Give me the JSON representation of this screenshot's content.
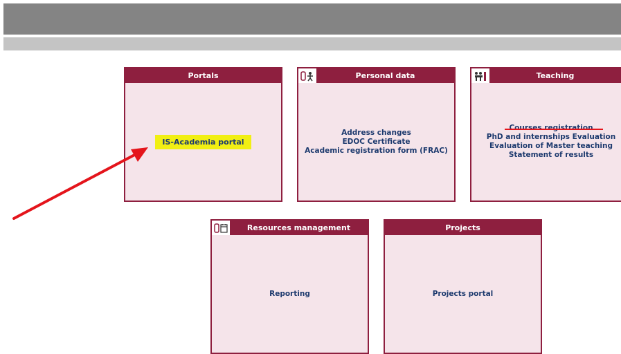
{
  "portals": {
    "title": "Portals",
    "items": [
      "IS-Academia portal"
    ]
  },
  "personal_data": {
    "title": "Personal data",
    "items": [
      "Address changes",
      "EDOC Certificate",
      "Academic registration form (FRAC)"
    ]
  },
  "teaching": {
    "title": "Teaching",
    "items": [
      "Courses registration",
      "PhD and internships Evaluation",
      "Evaluation of Master teaching",
      "Statement of results"
    ]
  },
  "resources": {
    "title": "Resources management",
    "items": [
      "Reporting"
    ]
  },
  "projects": {
    "title": "Projects",
    "items": [
      "Projects portal"
    ]
  },
  "colors": {
    "header": "#8e1f3f",
    "card_bg": "#f5e4ea",
    "link": "#1d3a6e",
    "highlight": "#f1ef13",
    "arrow": "#e4141b"
  }
}
